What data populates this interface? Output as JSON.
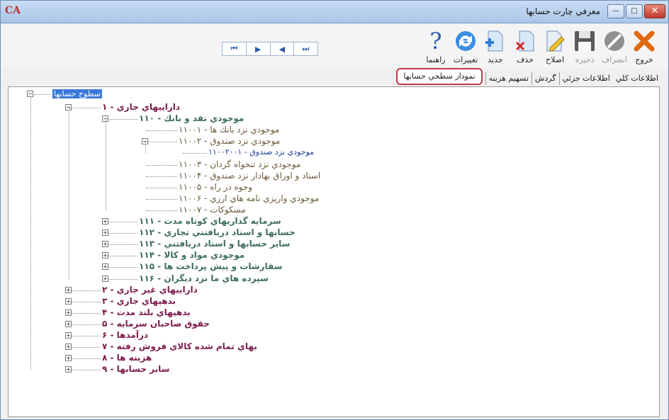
{
  "window": {
    "logo": "CA",
    "title": "معرفي چارت حسابها",
    "close_glyph": "✕",
    "maximize_glyph": "□",
    "minimize_glyph": "—"
  },
  "toolbar": {
    "nav": {
      "first": "⏮",
      "prev": "◀",
      "next": "▶",
      "last": "⏭"
    },
    "tools": [
      {
        "key": "help",
        "label": "راهنما",
        "icon": "help-icon",
        "enabled": true
      },
      {
        "key": "changes",
        "label": "تغييرات",
        "icon": "refresh-icon",
        "enabled": true
      },
      {
        "key": "new",
        "label": "جديد",
        "icon": "new-document-icon",
        "enabled": true
      },
      {
        "key": "delete",
        "label": "حذف",
        "icon": "delete-document-icon",
        "enabled": true
      },
      {
        "key": "edit",
        "label": "اصلاح",
        "icon": "pencil-icon",
        "enabled": true
      },
      {
        "key": "save",
        "label": "ذخيره",
        "icon": "save-icon",
        "enabled": false
      },
      {
        "key": "cancel",
        "label": "انصراف",
        "icon": "cancel-icon",
        "enabled": false
      },
      {
        "key": "exit",
        "label": "خروج",
        "icon": "exit-icon",
        "enabled": true
      }
    ]
  },
  "tabs": [
    {
      "label": "اطلاعات كلي",
      "active": false
    },
    {
      "label": "اطلاعات جزئي",
      "active": false
    },
    {
      "label": "گردش",
      "active": false
    },
    {
      "label": "تسهيم هزينه",
      "active": false
    },
    {
      "label": "نمودار سطحي حسابها",
      "active": true
    }
  ],
  "tree": {
    "root": "سطوح حسابها",
    "nodes": [
      {
        "label": "داراييهاي جاري - ۱",
        "level": 1,
        "expanded": true
      },
      {
        "label": "موجودي نقد و بانك - ۱۱۰",
        "level": 2,
        "expanded": true
      },
      {
        "label": "موجودي نزد بانك ها - ۱۱۰۰۱",
        "level": 3
      },
      {
        "label": "موجودي نزد صندوق - ۱۱۰۰۲",
        "level": 3,
        "expanded": true
      },
      {
        "label": "موجودي نزد صندوق - ۱۱۰۰۲۰۰۱",
        "level": 4
      },
      {
        "label": "موجودي نزد تنخواه گردان - ۱۱۰۰۳",
        "level": 3
      },
      {
        "label": "اسناد و اوراق بهادار نزد صندوق - ۱۱۰۰۴",
        "level": 3
      },
      {
        "label": "وجوه در راه - ۱۱۰۰۵",
        "level": 3
      },
      {
        "label": "موجودي واريزي نامه هاي ارزي - ۱۱۰۰۶",
        "level": 3
      },
      {
        "label": "مسكوكات - ۱۱۰۰۷",
        "level": 3
      },
      {
        "label": "سرمايه گذاريهاي كوتاه مدت - ۱۱۱",
        "level": 2,
        "expanded": false
      },
      {
        "label": "حسابها و اسناد دريافتني تجاري - ۱۱۲",
        "level": 2,
        "expanded": false
      },
      {
        "label": "ساير حسابها و اسناد دريافتني - ۱۱۳",
        "level": 2,
        "expanded": false
      },
      {
        "label": "موجودي مواد و كالا - ۱۱۴",
        "level": 2,
        "expanded": false
      },
      {
        "label": "سفارشات و پيش پرداخت ها - ۱۱۵",
        "level": 2,
        "expanded": false
      },
      {
        "label": "سپرده هاي ما نزد ديگران - ۱۱۶",
        "level": 2,
        "expanded": false
      },
      {
        "label": "داراييهاي غير جاري - ۲",
        "level": 1,
        "expanded": false
      },
      {
        "label": "بدهيهاي جاري - ۳",
        "level": 1,
        "expanded": false
      },
      {
        "label": "بدهيهاي بلند مدت - ۴",
        "level": 1,
        "expanded": false
      },
      {
        "label": "حقوق صاحبان سرمايه - ۵",
        "level": 1,
        "expanded": false
      },
      {
        "label": "درآمدها - ۶",
        "level": 1,
        "expanded": false
      },
      {
        "label": "بهاي تمام شده كالاي فروش رفته - ۷",
        "level": 1,
        "expanded": false
      },
      {
        "label": "هزينه ها - ۸",
        "level": 1,
        "expanded": false
      },
      {
        "label": "ساير حسابها - ۹",
        "level": 1,
        "expanded": false
      }
    ]
  },
  "colors": {
    "level1": "#7b1b4b",
    "level2": "#3e6d5a",
    "level3": "#6b5a3a",
    "level4": "#1f3f9a",
    "selection": "#3a78d8",
    "tab_highlight": "#c23a4a"
  }
}
